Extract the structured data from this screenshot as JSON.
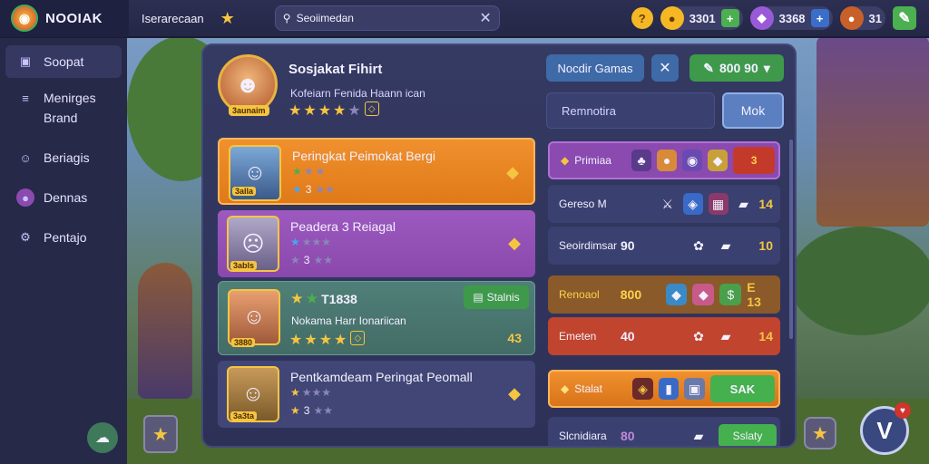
{
  "topbar": {
    "logo": "NOOIAK",
    "user": "Iserarecaan",
    "search_placeholder": "Seoiimedan",
    "currency1": "3301",
    "currency2": "3368",
    "currency3": "31"
  },
  "sidebar": {
    "items": [
      {
        "label": "Soopat"
      },
      {
        "label": "Menirges"
      },
      {
        "label": "Brand"
      },
      {
        "label": "Beriagis"
      },
      {
        "label": "Dennas"
      },
      {
        "label": "Pentajo"
      }
    ]
  },
  "panel": {
    "title": "Sosjakat Fihirt",
    "subtitle": "Kofeiarn Fenida Haann ican",
    "avatar_level": "3aunaim",
    "new_games_button": "Nocdir Gamas",
    "coins_button": "800 90",
    "input_value": "Remnotira",
    "mok_button": "Mok"
  },
  "cards": [
    {
      "title": "Peringkat Peimokat Bergi",
      "level": "3alla",
      "num": "3"
    },
    {
      "title": "Peadera 3 Reiagal",
      "level": "3abls",
      "num": "3"
    },
    {
      "title": "T1838",
      "subtitle": "Nokama Harr Ionariican",
      "level": "3880",
      "status_button": "Stalnis",
      "value": "43"
    },
    {
      "title": "Pentkamdeam Peringat Peomall",
      "level": "3a3ta",
      "num": "3"
    }
  ],
  "rows": [
    {
      "name": "Primiaa",
      "action": "3"
    },
    {
      "name": "Gereso M",
      "end": "14"
    },
    {
      "name": "Seoirdimsar",
      "value": "90",
      "end": "10"
    },
    {
      "name": "Renoaol",
      "value": "800",
      "end": "E 13"
    },
    {
      "name": "Emeten",
      "value": "40",
      "end": "14"
    },
    {
      "name": "Stalat",
      "button": "SAK"
    },
    {
      "name": "Slcnidiara",
      "value": "80",
      "button": "Sslaty"
    }
  ]
}
